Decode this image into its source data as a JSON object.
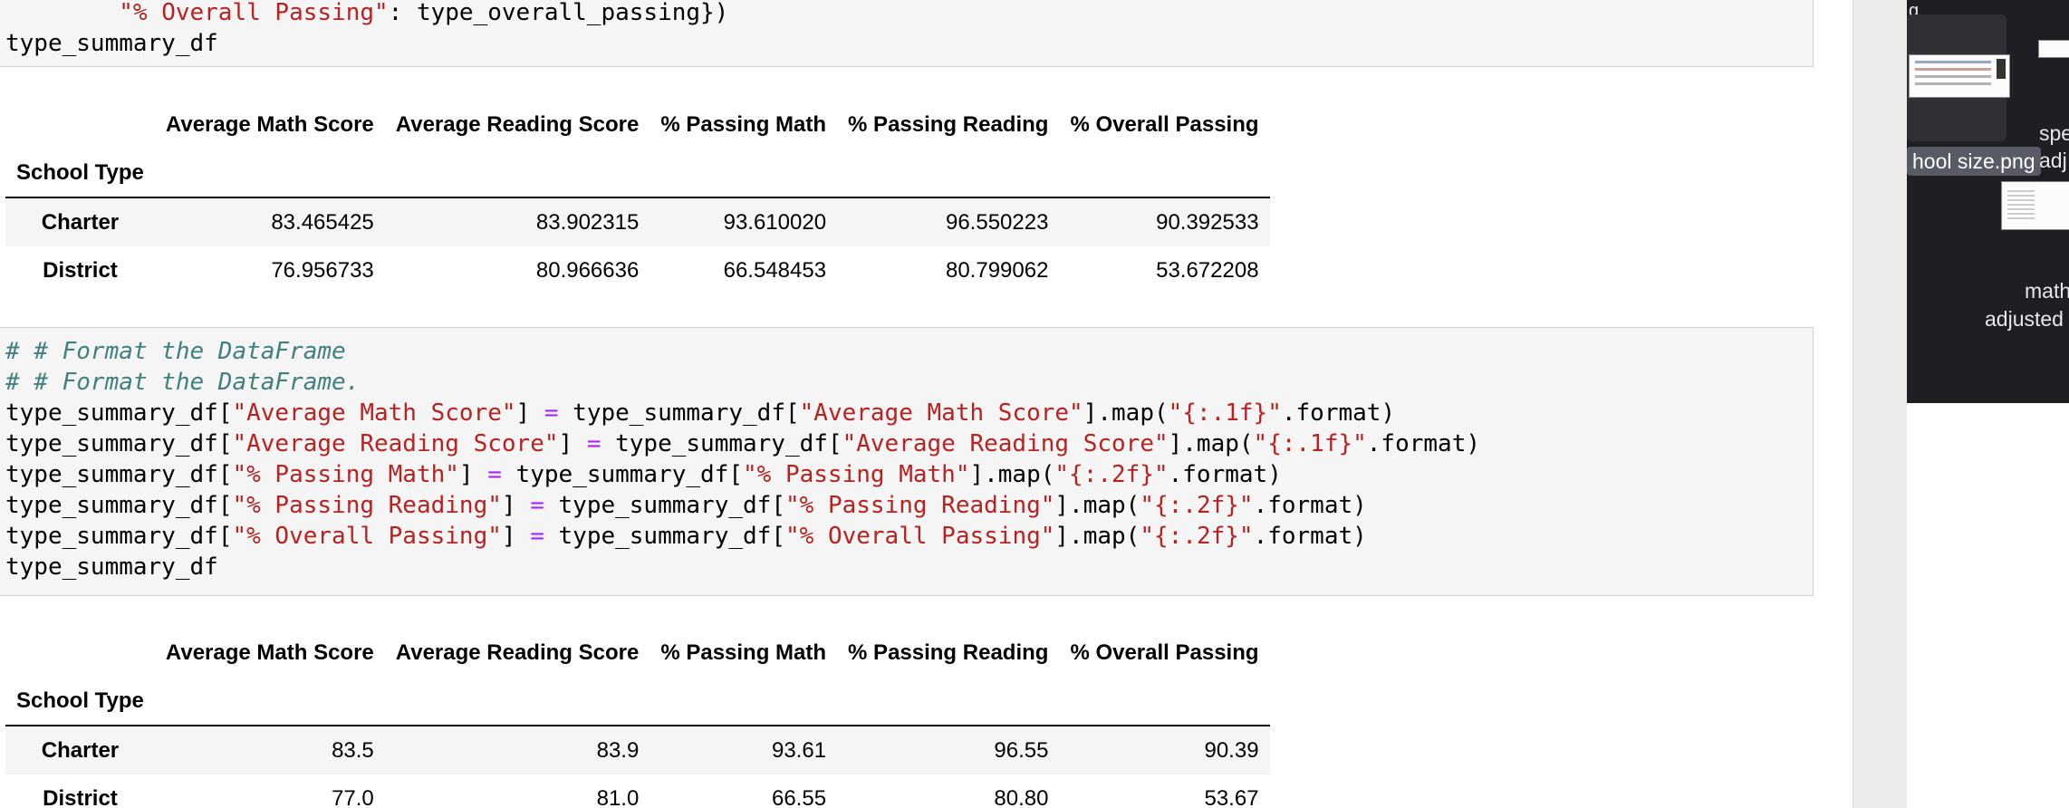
{
  "cell1": {
    "line1_key": "\"% Overall Passing\"",
    "line1_rest": ": type_overall_passing})",
    "line2": "type_summary_df"
  },
  "table1": {
    "columns": [
      "Average Math Score",
      "Average Reading Score",
      "% Passing Math",
      "% Passing Reading",
      "% Overall Passing"
    ],
    "index_name": "School Type",
    "rows": [
      {
        "label": "Charter",
        "values": [
          "83.465425",
          "83.902315",
          "93.610020",
          "96.550223",
          "90.392533"
        ]
      },
      {
        "label": "District",
        "values": [
          "76.956733",
          "80.966636",
          "66.548453",
          "80.799062",
          "53.672208"
        ]
      }
    ]
  },
  "cell2": {
    "comment1": "# # Format the DataFrame",
    "comment2": "# # Format the DataFrame.",
    "var": "type_summary_df",
    "lines": [
      {
        "col": "\"Average Math Score\"",
        "fmt": "\"{:.1f}\""
      },
      {
        "col": "\"Average Reading Score\"",
        "fmt": "\"{:.1f}\""
      },
      {
        "col": "\"% Passing Math\"",
        "fmt": "\"{:.2f}\""
      },
      {
        "col": "\"% Passing Reading\"",
        "fmt": "\"{:.2f}\""
      },
      {
        "col": "\"% Overall Passing\"",
        "fmt": "\"{:.2f}\""
      }
    ],
    "last_line": "type_summary_df"
  },
  "table2": {
    "columns": [
      "Average Math Score",
      "Average Reading Score",
      "% Passing Math",
      "% Passing Reading",
      "% Overall Passing"
    ],
    "index_name": "School Type",
    "rows": [
      {
        "label": "Charter",
        "values": [
          "83.5",
          "83.9",
          "93.61",
          "96.55",
          "90.39"
        ]
      },
      {
        "label": "District",
        "values": [
          "77.0",
          "81.0",
          "66.55",
          "80.80",
          "53.67"
        ]
      }
    ]
  },
  "desktop": {
    "top_fragment": "g",
    "file1_name": "hool size.png",
    "file2_line1": "spe",
    "file2_line2": "adj",
    "file3_line1": "math",
    "file3_line2": "adjusted"
  }
}
